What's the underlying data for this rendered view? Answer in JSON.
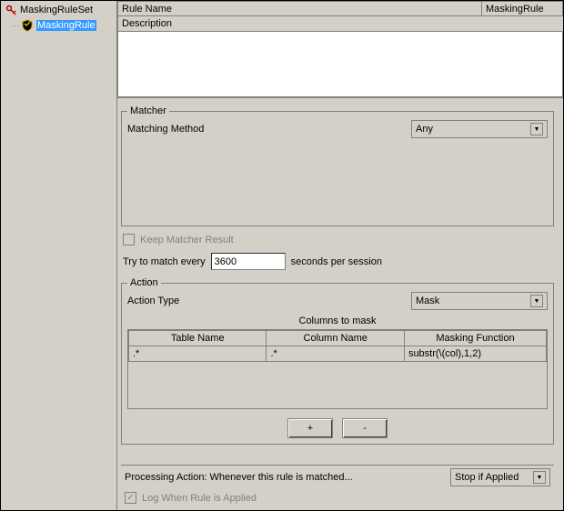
{
  "tree": {
    "root_label": "MaskingRuleSet",
    "child_label": "MaskingRule",
    "root_icon_name": "key-icon",
    "child_icon_name": "shield-icon"
  },
  "header": {
    "rule_name_label": "Rule Name",
    "rule_name_value": "MaskingRule",
    "description_label": "Description",
    "description_value": ""
  },
  "matcher": {
    "legend": "Matcher",
    "method_label": "Matching Method",
    "method_value": "Any",
    "keep_result_label": "Keep Matcher Result",
    "keep_result_checked": false
  },
  "match_every": {
    "prefix": "Try to match every",
    "value": "3600",
    "suffix": "seconds per session"
  },
  "action": {
    "legend": "Action",
    "type_label": "Action Type",
    "type_value": "Mask",
    "columns_title": "Columns to mask",
    "headers": {
      "table": "Table Name",
      "column": "Column Name",
      "func": "Masking Function"
    },
    "rows": [
      {
        "table": ".*",
        "column": ".*",
        "func": "substr(\\(col),1,2)"
      }
    ],
    "add_label": "+",
    "remove_label": "-"
  },
  "processing": {
    "label": "Processing Action: Whenever this rule is matched...",
    "value": "Stop if Applied"
  },
  "log": {
    "label": "Log When Rule is Applied",
    "checked": true
  }
}
